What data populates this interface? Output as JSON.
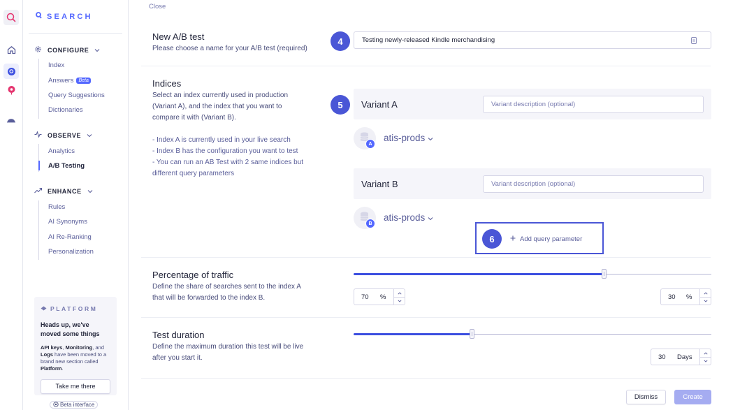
{
  "sidebar": {
    "brand": "SEARCH",
    "configure": {
      "label": "CONFIGURE",
      "items": [
        "Index",
        "Answers",
        "Query Suggestions",
        "Dictionaries"
      ],
      "beta_badge": "Beta"
    },
    "observe": {
      "label": "OBSERVE",
      "items": [
        "Analytics",
        "A/B Testing"
      ]
    },
    "enhance": {
      "label": "ENHANCE",
      "items": [
        "Rules",
        "AI Synonyms",
        "AI Re-Ranking",
        "Personalization"
      ]
    },
    "platform_card": {
      "title": "PLATFORM",
      "heading": "Heads up, we've moved some things",
      "body_prefix": "API keys",
      "body_sep1": ", ",
      "body_monitoring": "Monitoring",
      "body_sep2": ", and ",
      "body_logs": "Logs",
      "body_mid": " have been moved to a brand new section called ",
      "body_platform": "Platform",
      "body_end": ".",
      "button": "Take me there"
    },
    "beta_interface": "Beta interface"
  },
  "main": {
    "close": "Close",
    "name_section": {
      "title": "New A/B test",
      "description": "Please choose a name for your A/B test (required)",
      "input_value": "Testing newly-released Kindle merchandising",
      "step": "4"
    },
    "indices_section": {
      "title": "Indices",
      "desc_line1": "Select an index currently used in production",
      "desc_line2": "(Variant A), and the index that you want to",
      "desc_line3": "compare it with (Variant B).",
      "bullet1": "- Index A is currently used in your live search",
      "bullet2": "- Index B has the configuration you want to test",
      "bullet3": "- You can run an AB Test with 2 same indices but",
      "bullet4": "different query parameters",
      "step": "5",
      "variant_a": {
        "label": "Variant A",
        "placeholder": "Variant description (optional)",
        "index_name": "atis-prods",
        "badge": "A"
      },
      "variant_b": {
        "label": "Variant B",
        "placeholder": "Variant description (optional)",
        "index_name": "atis-prods",
        "badge": "B"
      },
      "add_query_step": "6",
      "add_query_label": "Add query parameter"
    },
    "traffic_section": {
      "title": "Percentage of traffic",
      "desc_line1": "Define the share of searches sent to the index A",
      "desc_line2": "that will be forwarded to the index B.",
      "value_a": "70",
      "value_b": "30",
      "unit": "%",
      "slider_fraction": 0.7
    },
    "duration_section": {
      "title": "Test duration",
      "desc_line1": "Define the maximum duration this test will be live",
      "desc_line2": "after you start it.",
      "value": "30",
      "unit": "Days",
      "slider_fraction": 0.33
    },
    "footer": {
      "dismiss": "Dismiss",
      "create": "Create"
    }
  },
  "colors": {
    "accent": "#5468ff",
    "step_badge": "#4a56d6",
    "create_disabled": "#a5acf1",
    "pink_icon": "#e5356f"
  }
}
